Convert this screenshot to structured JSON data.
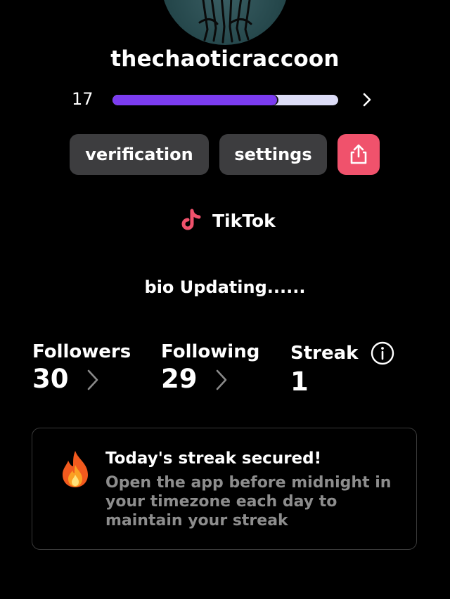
{
  "profile": {
    "username": "thechaoticraccoon",
    "level": "17",
    "level_progress": 0.73
  },
  "actions": {
    "verification_label": "verification",
    "settings_label": "settings",
    "share_icon": "share-icon"
  },
  "platform": {
    "icon": "tiktok-icon",
    "label": "TikTok"
  },
  "bio": "bio Updating......",
  "stats": {
    "followers_label": "Followers",
    "followers_value": "30",
    "following_label": "Following",
    "following_value": "29",
    "streak_label": "Streak",
    "streak_value": "1"
  },
  "streak_card": {
    "icon": "fire-icon",
    "title": "Today's streak secured!",
    "text": "Open the app before midnight in your timezone each day to maintain your streak"
  },
  "colors": {
    "background": "#000000",
    "progress_fill": "#7b3cf0",
    "progress_track": "#dcdcf6",
    "button": "#3d3d3f",
    "share_button": "#f0526c",
    "muted_text": "#8d8d8d"
  }
}
